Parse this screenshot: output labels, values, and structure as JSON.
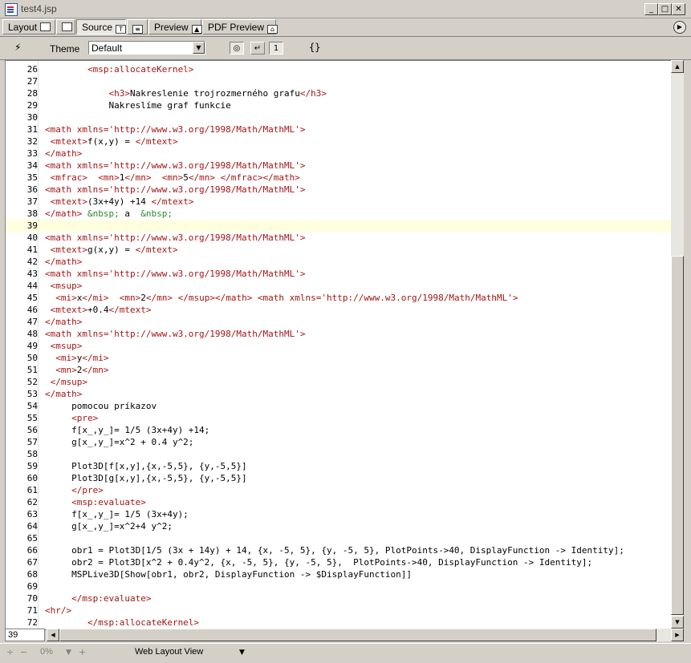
{
  "window": {
    "title": "test4.jsp"
  },
  "tabs": [
    {
      "label": "Layout"
    },
    {
      "label": ""
    },
    {
      "label": "Source"
    },
    {
      "label": ""
    },
    {
      "label": "Preview"
    },
    {
      "label": "PDF Preview"
    }
  ],
  "toolbar": {
    "theme_label": "Theme",
    "theme_value": "Default"
  },
  "editor": {
    "current_line": 39,
    "lines": [
      {
        "n": "26",
        "t": [
          [
            "tag",
            "        <msp:allocateKernel>"
          ]
        ]
      },
      {
        "n": "27",
        "t": []
      },
      {
        "n": "28",
        "t": [
          [
            "txt",
            "            "
          ],
          [
            "tag",
            "<h3>"
          ],
          [
            "txt",
            "Nakreslenie trojrozmerného grafu"
          ],
          [
            "tag",
            "</h3>"
          ]
        ]
      },
      {
        "n": "29",
        "t": [
          [
            "txt",
            "            Nakreslíme graf funkcie"
          ]
        ]
      },
      {
        "n": "30",
        "t": []
      },
      {
        "n": "31",
        "t": [
          [
            "tag",
            "<math xmlns='http://www.w3.org/1998/Math/MathML'>"
          ]
        ]
      },
      {
        "n": "32",
        "t": [
          [
            "tag",
            " <mtext>"
          ],
          [
            "txt",
            "f(x,y) = "
          ],
          [
            "tag",
            "</mtext>"
          ]
        ]
      },
      {
        "n": "33",
        "t": [
          [
            "tag",
            "</math>"
          ]
        ]
      },
      {
        "n": "34",
        "t": [
          [
            "tag",
            "<math xmlns='http://www.w3.org/1998/Math/MathML'>"
          ]
        ]
      },
      {
        "n": "35",
        "t": [
          [
            "tag",
            " <mfrac>  <mn>"
          ],
          [
            "txt",
            "1"
          ],
          [
            "tag",
            "</mn>  <mn>"
          ],
          [
            "txt",
            "5"
          ],
          [
            "tag",
            "</mn> </mfrac></math>"
          ]
        ]
      },
      {
        "n": "36",
        "t": [
          [
            "tag",
            "<math xmlns='http://www.w3.org/1998/Math/MathML'>"
          ]
        ]
      },
      {
        "n": "37",
        "t": [
          [
            "tag",
            " <mtext>"
          ],
          [
            "txt",
            "(3x+4y) +14 "
          ],
          [
            "tag",
            "</mtext>"
          ]
        ]
      },
      {
        "n": "38",
        "t": [
          [
            "tag",
            "</math> "
          ],
          [
            "ent",
            "&nbsp;"
          ],
          [
            "txt",
            " a  "
          ],
          [
            "ent",
            "&nbsp;"
          ]
        ]
      },
      {
        "n": "39",
        "t": []
      },
      {
        "n": "40",
        "t": [
          [
            "tag",
            "<math xmlns='http://www.w3.org/1998/Math/MathML'>"
          ]
        ]
      },
      {
        "n": "41",
        "t": [
          [
            "tag",
            " <mtext>"
          ],
          [
            "txt",
            "g(x,y) = "
          ],
          [
            "tag",
            "</mtext>"
          ]
        ]
      },
      {
        "n": "42",
        "t": [
          [
            "tag",
            "</math>"
          ]
        ]
      },
      {
        "n": "43",
        "t": [
          [
            "tag",
            "<math xmlns='http://www.w3.org/1998/Math/MathML'>"
          ]
        ]
      },
      {
        "n": "44",
        "t": [
          [
            "tag",
            " <msup>"
          ]
        ]
      },
      {
        "n": "45",
        "t": [
          [
            "tag",
            "  <mi>"
          ],
          [
            "txt",
            "x"
          ],
          [
            "tag",
            "</mi>  <mn>"
          ],
          [
            "txt",
            "2"
          ],
          [
            "tag",
            "</mn> </msup></math> <math xmlns='http://www.w3.org/1998/Math/MathML'>"
          ]
        ]
      },
      {
        "n": "46",
        "t": [
          [
            "tag",
            " <mtext>"
          ],
          [
            "txt",
            "+0.4"
          ],
          [
            "tag",
            "</mtext>"
          ]
        ]
      },
      {
        "n": "47",
        "t": [
          [
            "tag",
            "</math>"
          ]
        ]
      },
      {
        "n": "48",
        "t": [
          [
            "tag",
            "<math xmlns='http://www.w3.org/1998/Math/MathML'>"
          ]
        ]
      },
      {
        "n": "49",
        "t": [
          [
            "tag",
            " <msup>"
          ]
        ]
      },
      {
        "n": "50",
        "t": [
          [
            "tag",
            "  <mi>"
          ],
          [
            "txt",
            "y"
          ],
          [
            "tag",
            "</mi>"
          ]
        ]
      },
      {
        "n": "51",
        "t": [
          [
            "tag",
            "  <mn>"
          ],
          [
            "txt",
            "2"
          ],
          [
            "tag",
            "</mn>"
          ]
        ]
      },
      {
        "n": "52",
        "t": [
          [
            "tag",
            " </msup>"
          ]
        ]
      },
      {
        "n": "53",
        "t": [
          [
            "tag",
            "</math>"
          ]
        ]
      },
      {
        "n": "54",
        "t": [
          [
            "txt",
            "     pomocou príkazov"
          ]
        ]
      },
      {
        "n": "55",
        "t": [
          [
            "txt",
            "     "
          ],
          [
            "tag",
            "<pre>"
          ]
        ]
      },
      {
        "n": "56",
        "t": [
          [
            "txt",
            "     f[x_,y_]= 1/5 (3x+4y) +14;"
          ]
        ]
      },
      {
        "n": "57",
        "t": [
          [
            "txt",
            "     g[x_,y_]=x^2 + 0.4 y^2;"
          ]
        ]
      },
      {
        "n": "58",
        "t": []
      },
      {
        "n": "59",
        "t": [
          [
            "txt",
            "     Plot3D[f[x,y],{x,-5,5}, {y,-5,5}]"
          ]
        ]
      },
      {
        "n": "60",
        "t": [
          [
            "txt",
            "     Plot3D[g[x,y],{x,-5,5}, {y,-5,5}]"
          ]
        ]
      },
      {
        "n": "61",
        "t": [
          [
            "txt",
            "     "
          ],
          [
            "tag",
            "</pre>"
          ]
        ]
      },
      {
        "n": "62",
        "t": [
          [
            "txt",
            "     "
          ],
          [
            "tag",
            "<msp:evaluate>"
          ]
        ]
      },
      {
        "n": "63",
        "t": [
          [
            "txt",
            "     f[x_,y_]= 1/5 (3x+4y);"
          ]
        ]
      },
      {
        "n": "64",
        "t": [
          [
            "txt",
            "     g[x_,y_]=x^2+4 y^2;"
          ]
        ]
      },
      {
        "n": "65",
        "t": []
      },
      {
        "n": "66",
        "t": [
          [
            "txt",
            "     obr1 = Plot3D[1/5 (3x + 14y) + 14, {x, -5, 5}, {y, -5, 5}, PlotPoints->40, DisplayFunction -> Identity];"
          ]
        ]
      },
      {
        "n": "67",
        "t": [
          [
            "txt",
            "     obr2 = Plot3D[x^2 + 0.4y^2, {x, -5, 5}, {y, -5, 5},  PlotPoints->40, DisplayFunction -> Identity];"
          ]
        ]
      },
      {
        "n": "68",
        "t": [
          [
            "txt",
            "     MSPLive3D[Show[obr1, obr2, DisplayFunction -> $DisplayFunction]]"
          ]
        ]
      },
      {
        "n": "69",
        "t": []
      },
      {
        "n": "70",
        "t": [
          [
            "txt",
            "     "
          ],
          [
            "tag",
            "</msp:evaluate>"
          ]
        ]
      },
      {
        "n": "71",
        "t": [
          [
            "tag",
            "<hr/>"
          ]
        ]
      },
      {
        "n": "72",
        "t": [
          [
            "tag",
            "        </msp:allocateKernel>"
          ]
        ]
      }
    ]
  },
  "position_field": "39",
  "status": {
    "zoom": "0%",
    "view": "Web Layout View"
  },
  "colors": {
    "tag": "#a31515",
    "entity": "#2b8a2b",
    "current_line": "#ffffe0"
  }
}
